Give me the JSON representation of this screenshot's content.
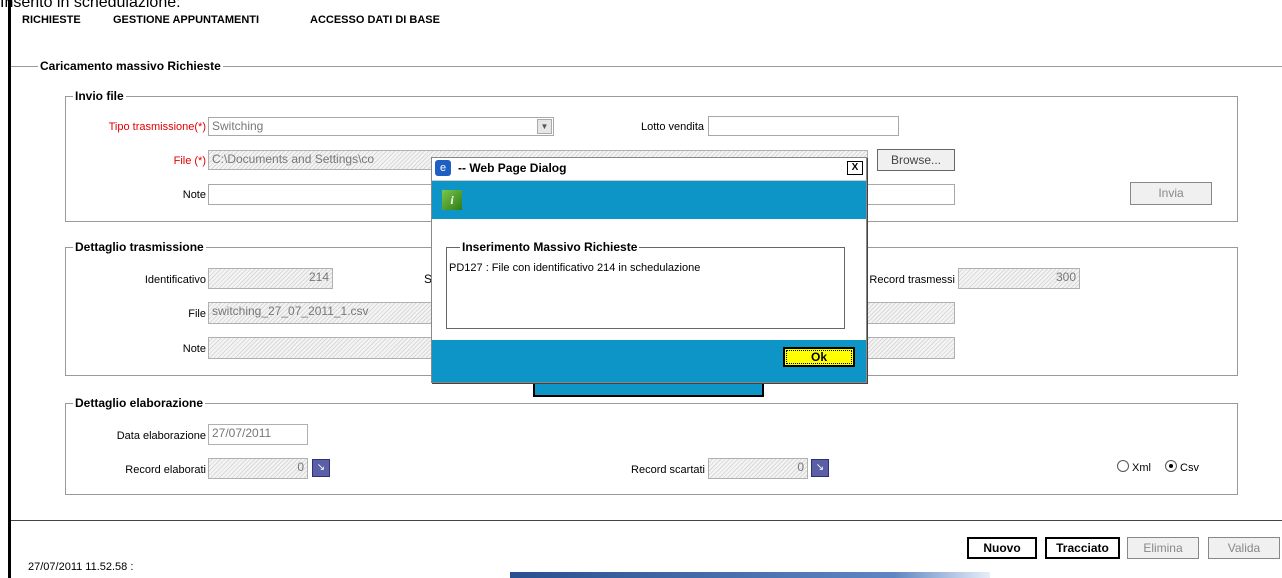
{
  "caption": "Inserito in schedulazione:",
  "menu": [
    "RICHIESTE",
    "GESTIONE APPUNTAMENTI",
    "ACCESSO DATI DI BASE"
  ],
  "section_title": "Caricamento massivo Richieste",
  "invio": {
    "legend": "Invio file",
    "tipo_label": "Tipo trasmissione(*)",
    "tipo_value": "Switching",
    "lotto_label": "Lotto vendita",
    "lotto_value": "",
    "file_label": "File (*)",
    "file_value": "C:\\Documents and Settings\\co",
    "browse": "Browse...",
    "note_label": "Note",
    "invia": "Invia"
  },
  "trasmissione": {
    "legend": "Dettaglio trasmissione",
    "id_label": "Identificativo",
    "id_value": "214",
    "s_label": "S",
    "record_label": "Record trasmessi",
    "record_value": "300",
    "file_label": "File",
    "file_value": "switching_27_07_2011_1.csv",
    "note_label": "Note"
  },
  "elaborazione": {
    "legend": "Dettaglio elaborazione",
    "data_label": "Data elaborazione",
    "data_value": "27/07/2011",
    "elab_label": "Record elaborati",
    "elab_value": "0",
    "scart_label": "Record scartati",
    "scart_value": "0",
    "xml": "Xml",
    "csv": "Csv",
    "selected_format": "Csv"
  },
  "footer_buttons": {
    "nuovo": "Nuovo",
    "tracciato": "Tracciato",
    "elimina": "Elimina",
    "valida": "Valida"
  },
  "status": "27/07/2011 11.52.58  :",
  "dialog": {
    "title": "-- Web Page Dialog",
    "legend": "Inserimento Massivo Richieste",
    "message": "PD127 : File con identificativo 214 in schedulazione",
    "ok": "Ok",
    "close": "X"
  }
}
